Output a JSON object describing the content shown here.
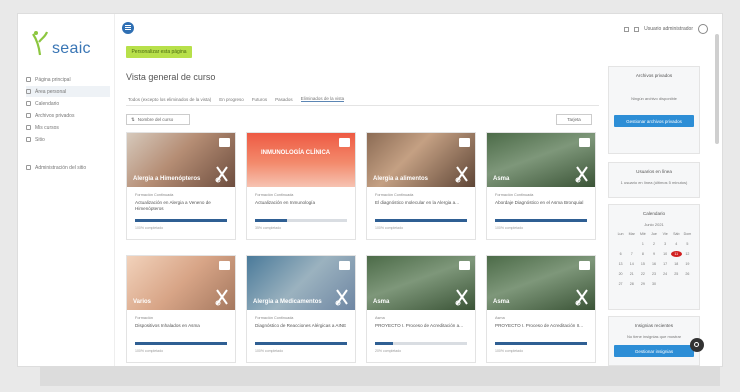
{
  "brand": {
    "logo_text": "seaic"
  },
  "sidebar": {
    "items": [
      {
        "label": "Página principal",
        "icon": "home-icon",
        "active": false
      },
      {
        "label": "Área personal",
        "icon": "dashboard-icon",
        "active": true
      },
      {
        "label": "Calendario",
        "icon": "calendar-icon",
        "active": false
      },
      {
        "label": "Archivos privados",
        "icon": "file-icon",
        "active": false
      },
      {
        "label": "Mis cursos",
        "icon": "graduation-icon",
        "active": false
      },
      {
        "label": "Sitio",
        "icon": "site-icon",
        "active": false
      },
      {
        "label": "Administración del sitio",
        "icon": "gear-icon",
        "active": false
      }
    ]
  },
  "topbar": {
    "user_name": "Usuario administrador"
  },
  "content": {
    "green_button": "Personalizar esta página",
    "page_title": "Vista general de curso",
    "filters": [
      "Todos (excepto los eliminados de la vista)",
      "En progreso",
      "Futuros",
      "Pasados",
      "Eliminados de la vista"
    ],
    "sort_label": "Nombre del curso",
    "view_label": "Tarjeta"
  },
  "cards": [
    {
      "image_title": "Alergia a Himenópteros",
      "category": "Formación Continuada",
      "name": "Actualización en Alergia a Veneno de Himenópteros",
      "progress": 100,
      "progress_text": "100% completado"
    },
    {
      "image_title": "INMUNOLOGÍA CLÍNICA",
      "category": "Formación Continuada",
      "name": "Actualización en Inmunología",
      "progress": 35,
      "progress_text": "35% completado"
    },
    {
      "image_title": "Alergia a alimentos",
      "category": "Formación Continuada",
      "name": "El diagnóstico molecular en la Alergia a...",
      "progress": 100,
      "progress_text": "100% completado"
    },
    {
      "image_title": "Asma",
      "category": "Formación Continuada",
      "name": "Abordaje Diagnóstico en el Asma Bronquial",
      "progress": 100,
      "progress_text": "100% completado"
    },
    {
      "image_title": "Varios",
      "category": "Formación",
      "name": "Dispositivos Inhalados en Asma",
      "progress": 100,
      "progress_text": "100% completado"
    },
    {
      "image_title": "Alergia a Medicamentos",
      "category": "Formación Continuada",
      "name": "Diagnóstico de Reacciones Alérgicas a AINE",
      "progress": 100,
      "progress_text": "100% completado"
    },
    {
      "image_title": "Asma",
      "category": "Asma",
      "name": "PROYECTO I. Proceso de Acreditación a...",
      "progress": 20,
      "progress_text": "20% completado"
    },
    {
      "image_title": "Asma",
      "category": "Asma",
      "name": "PROYECTO I. Proceso de Acreditación II...",
      "progress": 100,
      "progress_text": "100% completado"
    }
  ],
  "widgets": {
    "private_files": {
      "title": "Archivos privados",
      "desc": "Ningún archivo disponible",
      "button": "Gestionar archivos privados"
    },
    "online_users": {
      "title": "Usuarios en línea",
      "desc": "1 usuario en línea (últimos 5 minutos)"
    },
    "calendar": {
      "title": "Calendario",
      "month": "Junio 2021",
      "weekdays": [
        "Lun",
        "Mar",
        "Mié",
        "Jue",
        "Vie",
        "Sáb",
        "Dom"
      ],
      "days": [
        "",
        "",
        "1",
        "2",
        "3",
        "4",
        "5",
        "6",
        "7",
        "8",
        "9",
        "10",
        "11",
        "12",
        "13",
        "14",
        "15",
        "16",
        "17",
        "18",
        "19",
        "20",
        "21",
        "22",
        "23",
        "24",
        "25",
        "26",
        "27",
        "28",
        "29",
        "30"
      ],
      "today": "11"
    },
    "recent_badges": {
      "title": "Insignias recientes",
      "desc": "No tiene insignias que mostrar",
      "button": "Gestionar insignias"
    }
  }
}
